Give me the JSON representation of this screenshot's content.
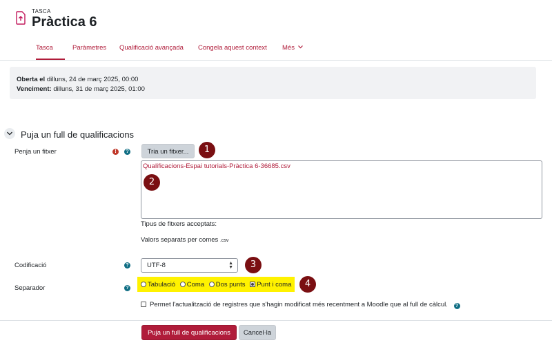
{
  "header": {
    "crumb": "TASCA",
    "title": "Pràctica 6"
  },
  "tabs": [
    {
      "label": "Tasca"
    },
    {
      "label": "Paràmetres"
    },
    {
      "label": "Qualificació avançada"
    },
    {
      "label": "Congela aquest context"
    },
    {
      "label": "Més"
    }
  ],
  "dates": {
    "opened_label": "Oberta el",
    "opened_value": " dilluns, 24 de març 2025, 00:00",
    "due_label": "Venciment:",
    "due_value": " dilluns, 31 de març 2025, 01:00"
  },
  "section": {
    "title": "Puja un full de qualificacions"
  },
  "form": {
    "file_label": "Penja un fitxer",
    "choose_file_button": "Tria un fitxer...",
    "file_name": "Qualificacions-Espai tutorials-Pràctica 6-36685.csv",
    "accepted_types_label": "Tipus de fitxers acceptats:",
    "accepted_type_name": "Valors separats per comes",
    "accepted_type_ext": ".csv",
    "encoding_label": "Codificació",
    "encoding_value": "UTF-8",
    "separator_label": "Separador",
    "separator_options": [
      "Tabulació",
      "Coma",
      "Dos punts",
      "Punt i coma"
    ],
    "separator_selected": "Punt i coma",
    "checkbox_label": "Permet l'actualització de registres que s'hagin modificat més recentment a Moodle que al full de càlcul.",
    "checkbox_checked": false,
    "submit_button": "Puja un full de qualificacions",
    "cancel_button": "Cancel·la"
  },
  "markers": [
    "1",
    "2",
    "3",
    "4"
  ],
  "colors": {
    "accent": "#b01c3a",
    "help": "#0f6e84",
    "required": "#c0392b",
    "marker": "#7a0f12",
    "highlight": "#fff200"
  }
}
